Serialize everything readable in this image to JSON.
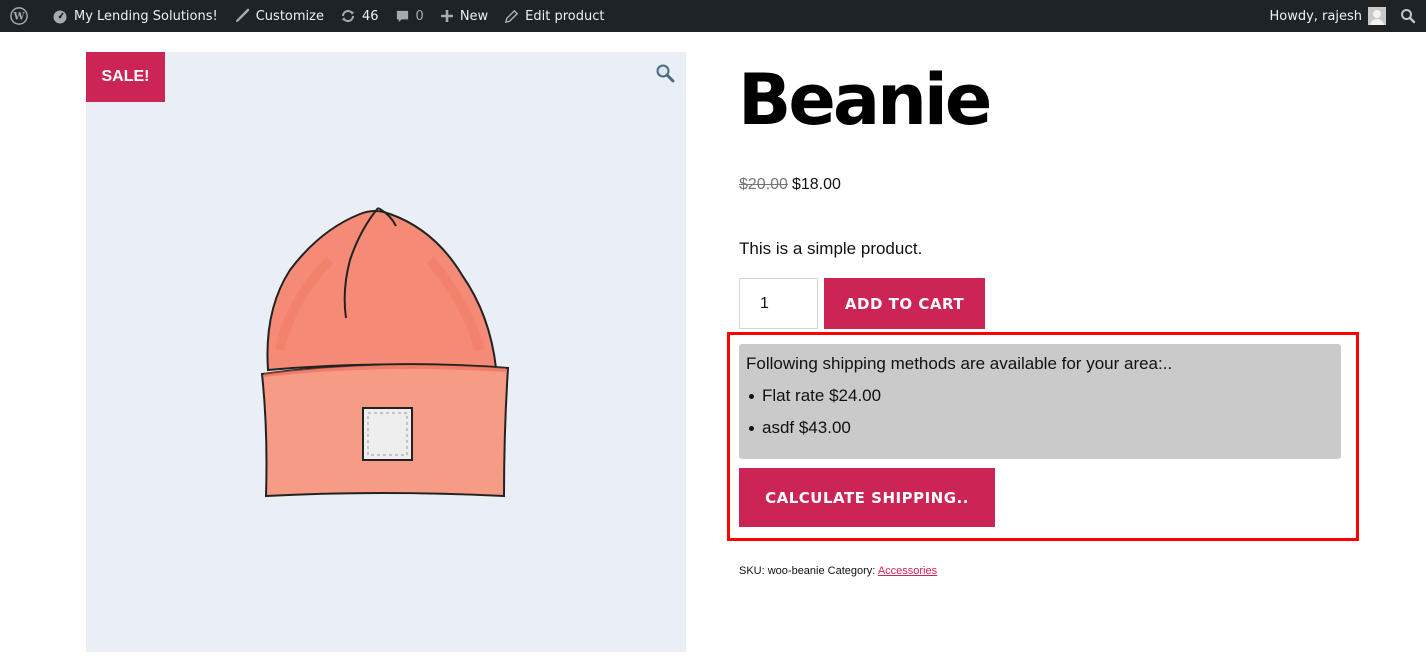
{
  "adminbar": {
    "site_name": "My Lending Solutions!",
    "customize": "Customize",
    "updates_count": "46",
    "comments_count": "0",
    "new_label": "New",
    "edit_label": "Edit product",
    "howdy": "Howdy, rajesh"
  },
  "product": {
    "sale_badge": "SALE!",
    "title": "Beanie",
    "regular_price": "$20.00",
    "sale_price": "$18.00",
    "description": "This is a simple product.",
    "quantity": "1",
    "add_to_cart": "ADD TO CART"
  },
  "shipping": {
    "intro": "Following shipping methods are available for your area:..",
    "methods": [
      {
        "label": "Flat rate $24.00"
      },
      {
        "label": "asdf $43.00"
      }
    ],
    "calculate_button": "CALCULATE SHIPPING.."
  },
  "meta": {
    "sku_text": "SKU: woo-beanie Category:",
    "category_link": "Accessories"
  },
  "colors": {
    "accent": "#cc2454",
    "adminbar_bg": "#1d2327",
    "gallery_bg": "#e9eff4",
    "shipping_box_bg": "#cacaca",
    "highlight": "#ff0000"
  },
  "icons": [
    "wordpress-logo-icon",
    "dashboard-icon",
    "brush-icon",
    "updates-icon",
    "comment-icon",
    "plus-icon",
    "pencil-icon",
    "search-icon",
    "zoom-icon"
  ]
}
